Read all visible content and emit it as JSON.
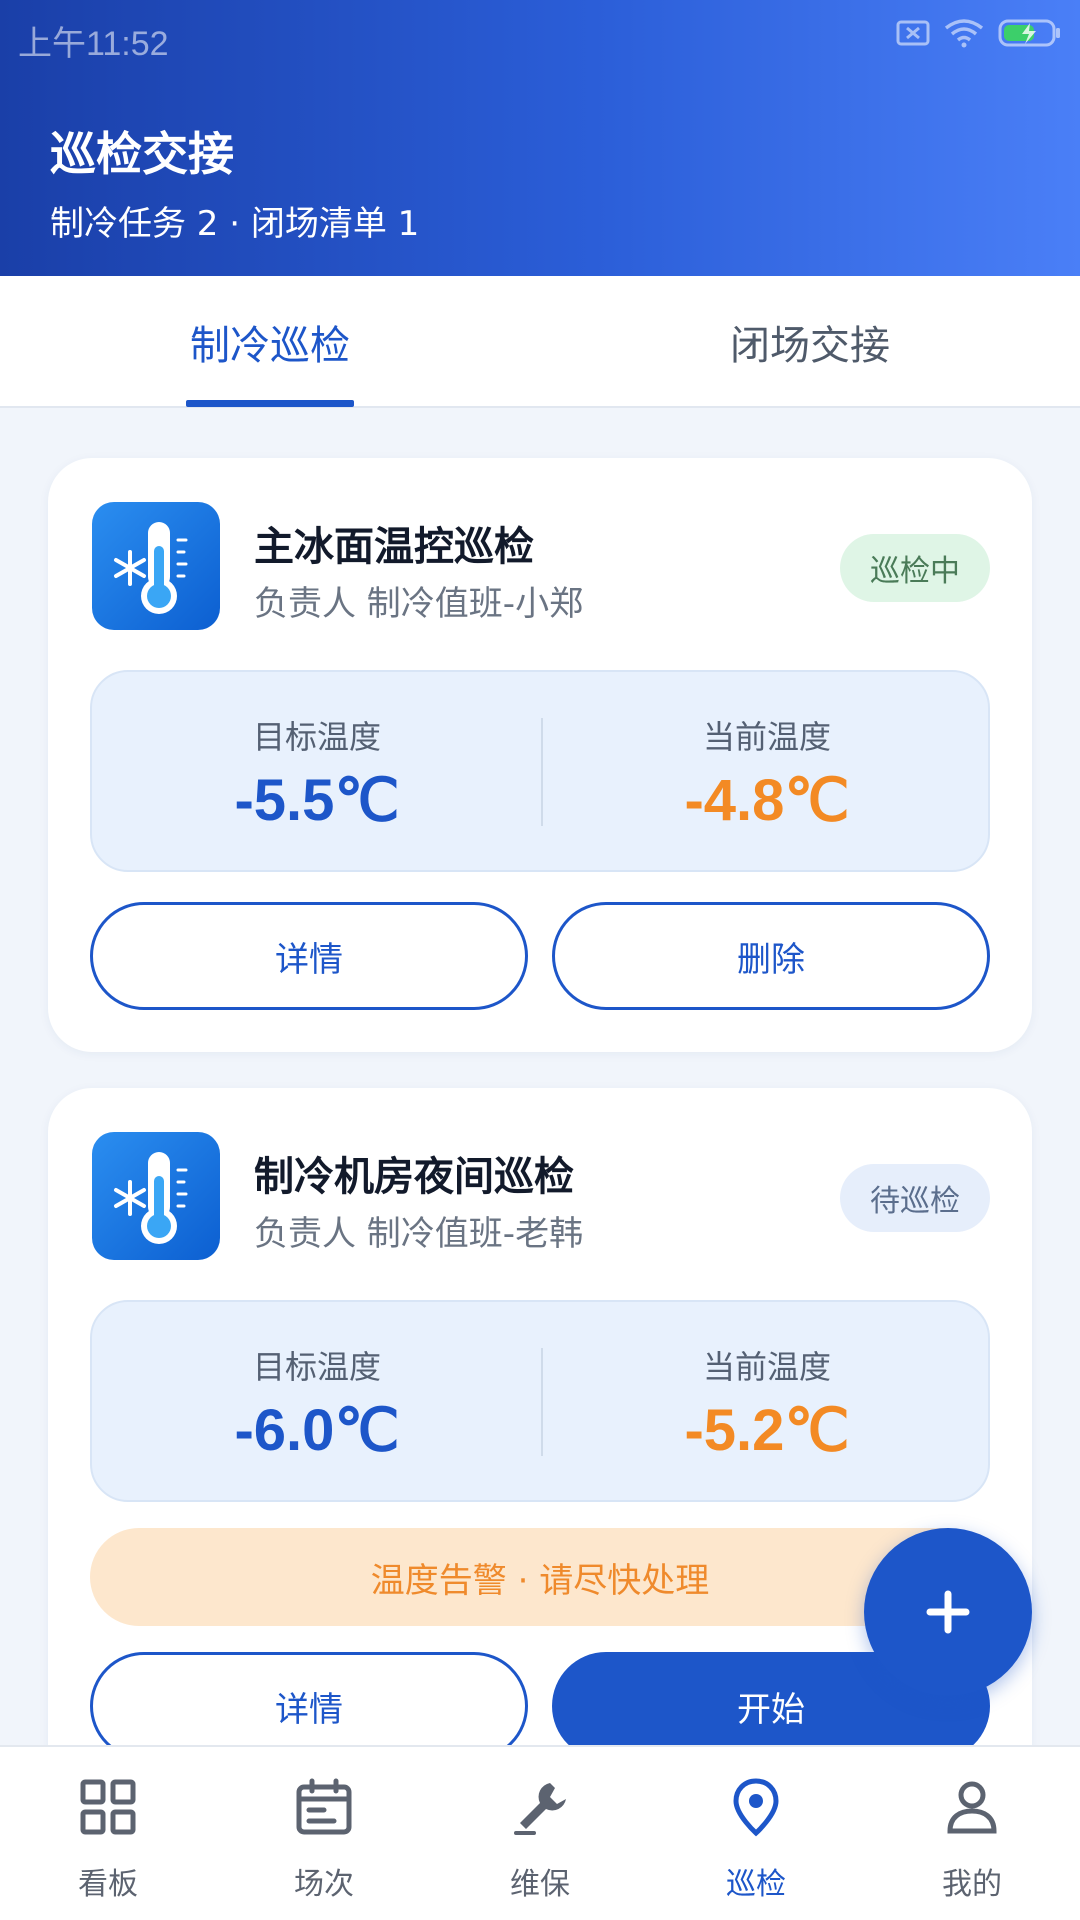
{
  "status_bar": {
    "time": "上午11:52"
  },
  "header": {
    "title": "巡检交接",
    "subtitle": "制冷任务 2 · 闭场清单 1"
  },
  "tabs": [
    {
      "label": "制冷巡检",
      "active": true
    },
    {
      "label": "闭场交接",
      "active": false
    }
  ],
  "cards": [
    {
      "title": "主冰面温控巡检",
      "owner": "负责人 制冷值班-小郑",
      "status": "巡检中",
      "target_label": "目标温度",
      "target_value": "-5.5℃",
      "current_label": "当前温度",
      "current_value": "-4.8℃",
      "buttons": [
        "详情",
        "删除"
      ]
    },
    {
      "title": "制冷机房夜间巡检",
      "owner": "负责人 制冷值班-老韩",
      "status": "待巡检",
      "target_label": "目标温度",
      "target_value": "-6.0℃",
      "current_label": "当前温度",
      "current_value": "-5.2℃",
      "alert": "温度告警 · 请尽快处理",
      "buttons": [
        "详情",
        "开始"
      ]
    }
  ],
  "bottom_nav": [
    {
      "label": "看板",
      "icon": "grid-icon"
    },
    {
      "label": "场次",
      "icon": "calendar-icon"
    },
    {
      "label": "维保",
      "icon": "wrench-icon"
    },
    {
      "label": "巡检",
      "icon": "location-pin-icon",
      "active": true
    },
    {
      "label": "我的",
      "icon": "person-icon"
    }
  ],
  "colors": {
    "primary": "#1d56c9",
    "warning": "#f38a24",
    "header_gradient_start": "#1a3fa8",
    "header_gradient_end": "#4a7ff7"
  }
}
